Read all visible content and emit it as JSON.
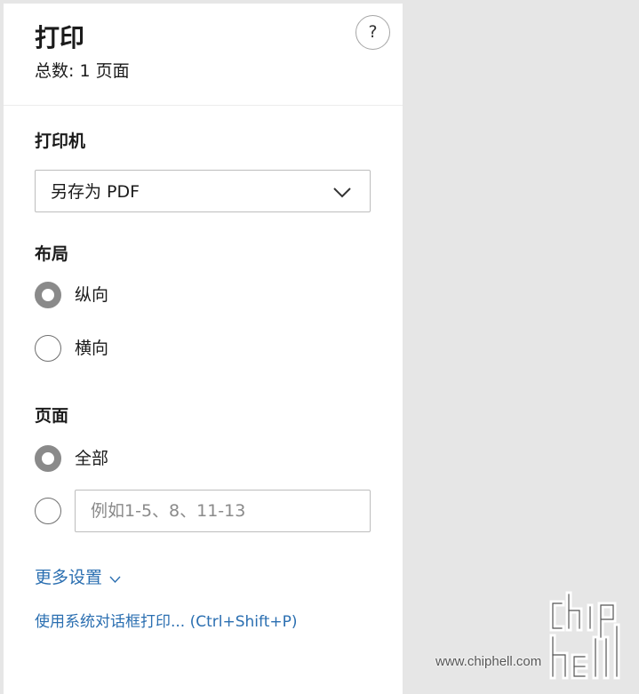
{
  "header": {
    "title": "打印",
    "total": "总数: 1 页面",
    "help_glyph": "?"
  },
  "printer": {
    "label": "打印机",
    "selected": "另存为 PDF"
  },
  "layout": {
    "label": "布局",
    "options": [
      {
        "label": "纵向",
        "checked": true
      },
      {
        "label": "横向",
        "checked": false
      }
    ]
  },
  "pages": {
    "label": "页面",
    "options": [
      {
        "label": "全部",
        "checked": true
      }
    ],
    "custom_range": {
      "value": "",
      "placeholder": "例如1-5、8、11-13",
      "checked": false
    }
  },
  "more_settings": {
    "label": "更多设置"
  },
  "system_dialog": {
    "label": "使用系统对话框打印... (Ctrl+Shift+P)"
  },
  "watermark": {
    "url": "www.chiphell.com",
    "logo": "chip hell"
  },
  "colors": {
    "link": "#2b6fb1",
    "radio_checked": "#8a8a8a",
    "background": "#e6e6e6",
    "panel": "#ffffff"
  },
  "icons": {
    "help": "question-circle-icon",
    "select_chevron": "chevron-down-icon",
    "more_chevron": "chevron-down-small-icon"
  }
}
